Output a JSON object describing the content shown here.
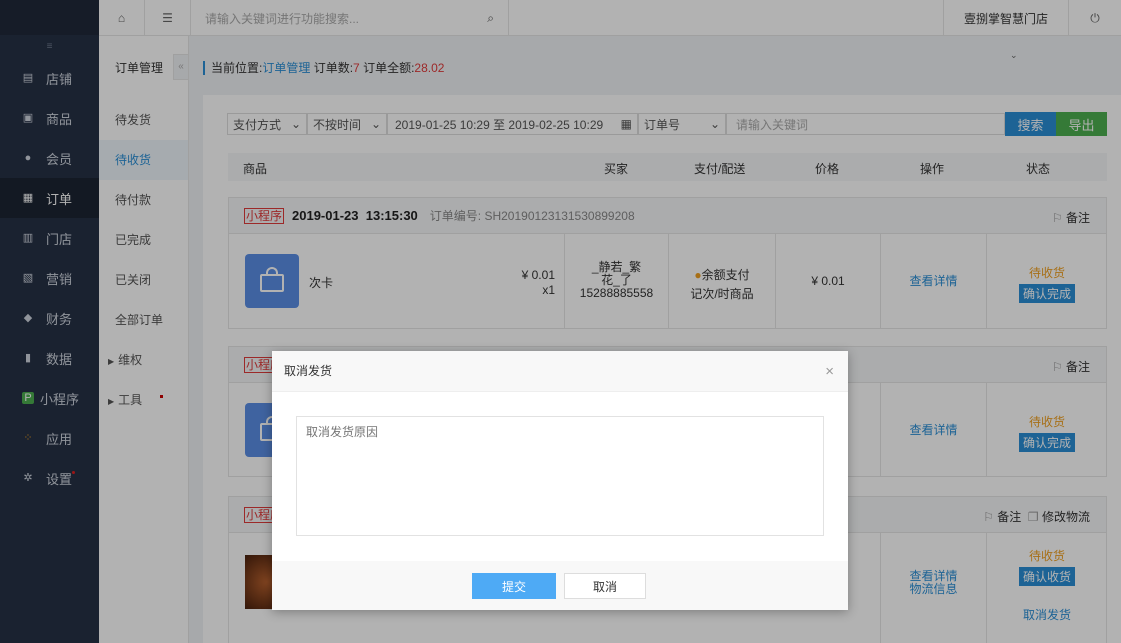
{
  "nav": {
    "items": [
      {
        "label": "店铺",
        "icon": "store-icon"
      },
      {
        "label": "商品",
        "icon": "goods-icon"
      },
      {
        "label": "会员",
        "icon": "user-icon"
      },
      {
        "label": "订单",
        "icon": "order-icon"
      },
      {
        "label": "门店",
        "icon": "shop-icon"
      },
      {
        "label": "营销",
        "icon": "gift-icon"
      },
      {
        "label": "财务",
        "icon": "money-bag-icon"
      },
      {
        "label": "数据",
        "icon": "bar-chart-icon"
      },
      {
        "label": "小程序",
        "icon": "miniprogram-icon"
      },
      {
        "label": "应用",
        "icon": "apps-icon"
      },
      {
        "label": "设置",
        "icon": "gear-icon"
      }
    ],
    "active_index": 3
  },
  "topbar": {
    "search_placeholder": "请输入关键词进行功能搜索...",
    "store_name": "壹捌掌智慧门店"
  },
  "submenu": {
    "title": "订单管理",
    "items": [
      "待发货",
      "待收货",
      "待付款",
      "已完成",
      "已关闭",
      "全部订单"
    ],
    "active_index": 1,
    "groups": [
      "维权",
      "工具"
    ]
  },
  "breadcrumb": {
    "prefix": "当前位置:",
    "page": "订单管理",
    "count_label": "订单数:",
    "count": "7",
    "amount_label": "订单全额:",
    "amount": "28.02"
  },
  "filters": {
    "pay_method": "支付方式",
    "time_sort": "不按时间",
    "date_range": "2019-01-25 10:29 至 2019-02-25 10:29",
    "field": "订单号",
    "keyword_placeholder": "请输入关键词",
    "search_btn": "搜索",
    "export_btn": "导出"
  },
  "table_headers": [
    "商品",
    "买家",
    "支付/配送",
    "价格",
    "操作",
    "状态"
  ],
  "orders": [
    {
      "tag": "小程序",
      "date": "2019-01-23",
      "time": "13:15:30",
      "order_no": "订单编号: SH20190123131530899208",
      "remark": "备注",
      "product": "次卡",
      "unit_price": "¥ 0.01",
      "qty": "x1",
      "buyer_name": "_静若_繁花_了",
      "buyer_phone": "15288885558",
      "pay": "余额支付",
      "delivery": "记次/时商品",
      "price": "¥ 0.01",
      "action": "查看详情",
      "status": "待收货",
      "status_btn": "确认完成"
    },
    {
      "tag": "小程序",
      "remark": "备注",
      "action": "查看详情",
      "status": "待收货",
      "status_btn": "确认完成"
    },
    {
      "tag": "小程序",
      "remark": "备注",
      "edit_logistics": "修改物流",
      "action": "查看详情",
      "action2": "物流信息",
      "status": "待收货",
      "status_btn": "确认收货",
      "cancel_ship": "取消发货"
    }
  ],
  "modal": {
    "title": "取消发货",
    "close": "×",
    "placeholder": "取消发货原因",
    "submit": "提交",
    "cancel": "取消"
  },
  "colors": {
    "sidebar": "#263145",
    "accent": "#2a8fd6",
    "status": "#f0a020",
    "green": "#4caf50",
    "red": "#e03b3b"
  }
}
